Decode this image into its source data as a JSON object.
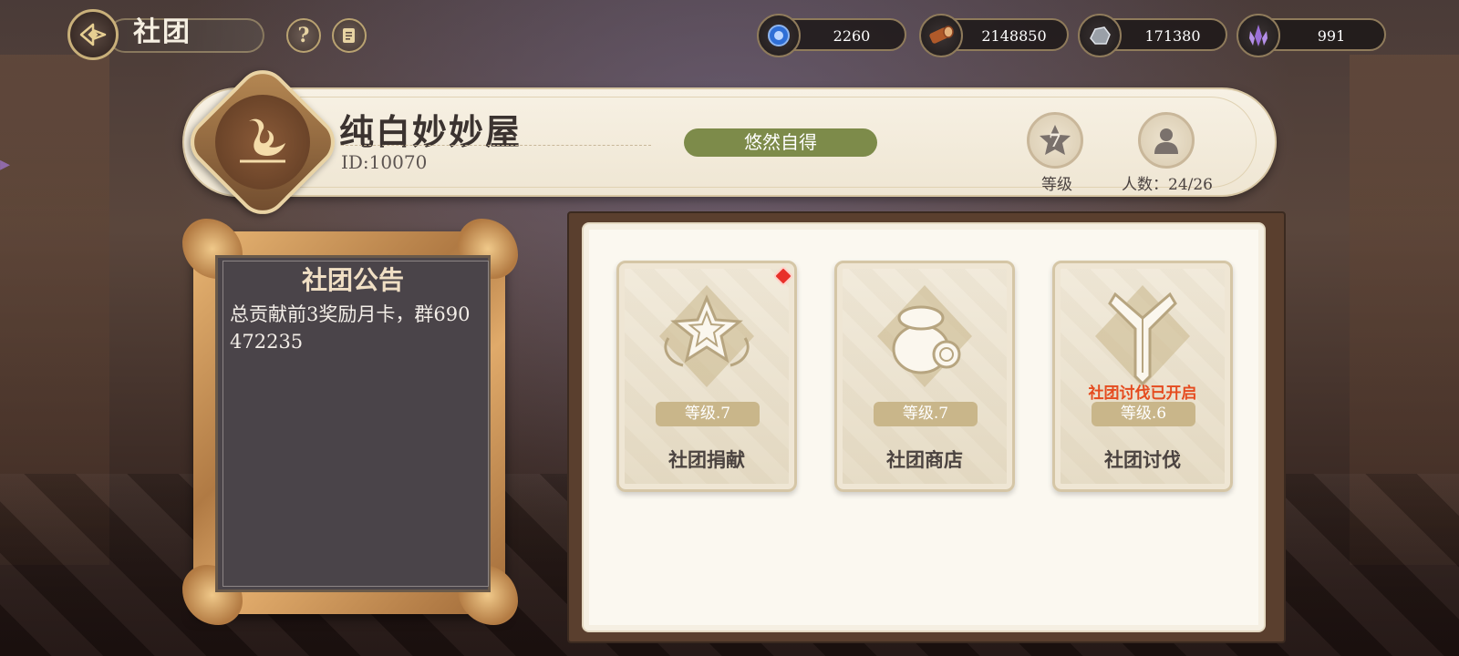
{
  "header": {
    "title": "社团"
  },
  "resources": [
    {
      "icon": "blue-badge-icon",
      "value": "2260",
      "color": "#2f6fd6"
    },
    {
      "icon": "wood-log-icon",
      "value": "2148850",
      "color": "#b05a2a"
    },
    {
      "icon": "iron-ore-icon",
      "value": "171380",
      "color": "#9aa0a8"
    },
    {
      "icon": "purple-crystal-icon",
      "value": "991",
      "color": "#9b6fd8"
    }
  ],
  "club": {
    "name": "纯白妙妙屋",
    "id": "ID:10070",
    "motto": "悠然自得",
    "level_value": "7",
    "level_label": "等级",
    "members_label": "人数：24/26"
  },
  "announcement": {
    "title": "社团公告",
    "text": "总贡献前3奖励月卡，群690472235"
  },
  "functions": [
    {
      "name": "社团捐献",
      "level": "等级.7",
      "alert": "",
      "has_red_dot": true,
      "icon": "donation-star-icon"
    },
    {
      "name": "社团商店",
      "level": "等级.7",
      "alert": "",
      "has_red_dot": false,
      "icon": "coin-bag-icon"
    },
    {
      "name": "社团讨伐",
      "level": "等级.6",
      "alert": "社团讨伐已开启",
      "has_red_dot": false,
      "icon": "crossed-swords-icon"
    }
  ],
  "colors": {
    "accent_green": "#7d8b4a",
    "alert_red": "#e54b1f",
    "frame_gold": "#c9a06a"
  }
}
